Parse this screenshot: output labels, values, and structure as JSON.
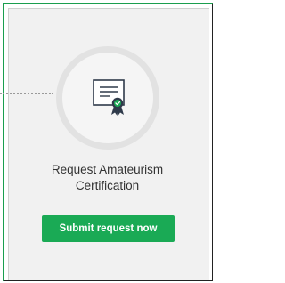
{
  "card": {
    "title_line1": "Request Amateurism",
    "title_line2": "Certification",
    "icon": "certificate-icon",
    "button_label": "Submit request now"
  },
  "colors": {
    "accent": "#1aaa55",
    "border": "#1a9e4e",
    "panel_bg": "#f1f1f1",
    "text": "#333333"
  }
}
